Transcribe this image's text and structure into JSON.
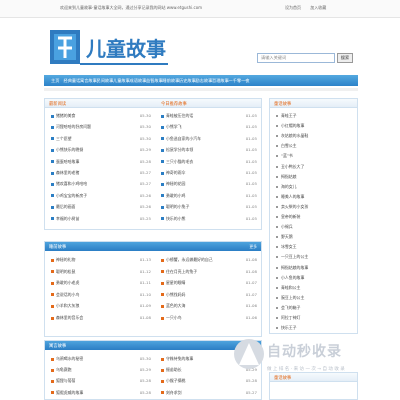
{
  "topbar": {
    "welcome": "欢迎来到儿童故事-童话故事大全网，通过分享记录我的网站 www.etgushi.com",
    "links": [
      "设为首页",
      "加入收藏"
    ]
  },
  "logo": {
    "text": "儿童故事"
  },
  "search": {
    "placeholder": "请输入关键词",
    "button": "搜索"
  },
  "nav": [
    "主页",
    "经典童话",
    "寓言故事",
    "民间故事",
    "儿童故事",
    "成语故事",
    "益智故事",
    "睡前故事",
    "历史故事",
    "励志故事",
    "哲理故事",
    "一千零一夜"
  ],
  "box_latest": {
    "title": "最新阅读",
    "col1": [
      {
        "t": "猪猪的美食",
        "d": "05-30"
      },
      {
        "t": "河狸哈哈的卧房问题",
        "d": "05-30"
      },
      {
        "t": "三个愿望",
        "d": "05-30"
      },
      {
        "t": "小熊快乐的晚餐",
        "d": "05-29"
      },
      {
        "t": "蛋蛋哈哈故事",
        "d": "05-28"
      },
      {
        "t": "森林里的老猪",
        "d": "05-27"
      },
      {
        "t": "猪欢喜和小鸡哈哈",
        "d": "05-27"
      },
      {
        "t": "小鸡宝宝的新房子",
        "d": "05-26"
      },
      {
        "t": "最后的画面",
        "d": "05-26"
      },
      {
        "t": "幸福的小树苗",
        "d": "05-25"
      }
    ],
    "col2_title": "今日推荐故事",
    "col2": [
      {
        "t": "青蛙被压住的话",
        "d": "01-05"
      },
      {
        "t": "小熊学飞",
        "d": "01-05"
      },
      {
        "t": "小鱼选自家的小汽车",
        "d": "01-05"
      },
      {
        "t": "松鼠学分的本领",
        "d": "01-05"
      },
      {
        "t": "三只小猫的毛衣",
        "d": "01-05"
      },
      {
        "t": "神奇的雨伞",
        "d": "01-05"
      },
      {
        "t": "神秘的花园",
        "d": "01-05"
      },
      {
        "t": "勇敢的小鸡",
        "d": "01-05"
      },
      {
        "t": "聪明的小兔子",
        "d": "01-05"
      },
      {
        "t": "快乐的小熊",
        "d": "01-05"
      }
    ]
  },
  "box_fairy": {
    "title": "睡前故事",
    "more": "更多",
    "col1": [
      {
        "t": "神秘的礼物",
        "d": "01-13"
      },
      {
        "t": "聪明的松鼠",
        "d": "01-12"
      },
      {
        "t": "勇敢的小老虎",
        "d": "01-11"
      },
      {
        "t": "会说话的小鸟",
        "d": "01-10"
      },
      {
        "t": "小羊和大灰狼",
        "d": "01-09"
      },
      {
        "t": "森林里的音乐会",
        "d": "01-08"
      }
    ],
    "col2": [
      {
        "t": "小螃蟹，永远做最好的自己",
        "d": "01-08"
      },
      {
        "t": "住在月亮上的兔子",
        "d": "01-08"
      },
      {
        "t": "星星的眼睛",
        "d": "01-07"
      },
      {
        "t": "小熊找妈妈",
        "d": "01-07"
      },
      {
        "t": "蓝色的大海",
        "d": "01-06"
      },
      {
        "t": "一只小鸟",
        "d": "01-06"
      }
    ]
  },
  "box_proverb": {
    "title": "寓言故事",
    "more": "更多",
    "col1": [
      {
        "t": "乌鸦喝水的秘密",
        "d": "05-30"
      },
      {
        "t": "乌龟赛跑",
        "d": "05-29"
      },
      {
        "t": "狐狸与葡萄",
        "d": "05-28"
      },
      {
        "t": "狐假虎威的故事",
        "d": "05-28"
      }
    ],
    "col2": [
      {
        "t": "守株待兔的故事",
        "d": "05-30"
      },
      {
        "t": "揠苗助长",
        "d": "05-29"
      },
      {
        "t": "小猴子摘桃",
        "d": "05-28"
      },
      {
        "t": "刻舟求剑",
        "d": "05-27"
      }
    ]
  },
  "sidebar": {
    "title": "童话故事",
    "items": [
      "青蛙王子",
      "小红帽的故事",
      "灰姑娘的水晶鞋",
      "白雪公主",
      "“蓝”书",
      "丑小鸭长大了",
      "拇指姑娘",
      "海的女儿",
      "睡美人的故事",
      "卖火柴的小女孩",
      "皇帝的新装",
      "小锡兵",
      "野天鹅",
      "冰雪女王",
      "一只豆上的公主",
      "拇指姑娘的故事",
      "小人鱼的故事",
      "青蛙和公主",
      "豌豆上的公主",
      "会飞的箱子",
      "阿拉丁神灯",
      "快乐王子"
    ],
    "title2": "童话故事"
  },
  "watermark": {
    "brand": "自动秒收录",
    "slogan": "做 上 排 名 · 来 访 一 次 → 自 动 收 录"
  }
}
